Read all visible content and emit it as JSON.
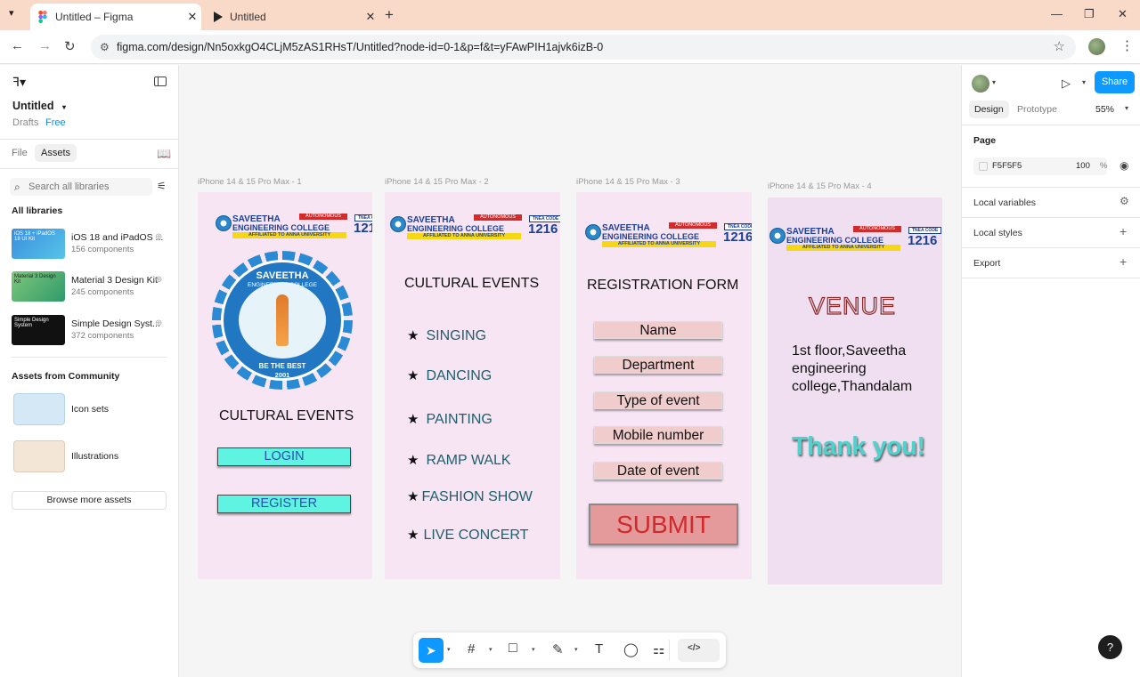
{
  "browser": {
    "tabs": [
      {
        "title": "Untitled – Figma",
        "close": "✕"
      },
      {
        "title": "Untitled",
        "close": "✕"
      }
    ],
    "new_tab": "+",
    "url": "figma.com/design/Nn5oxkgO4CLjM5zAS1RHsT/Untitled?node-id=0-1&p=f&t=yFAwPIH1ajvk6izB-0",
    "icons": [
      "chevron-down-icon",
      "figma-favicon",
      "play-favicon",
      "minimize-icon",
      "maximize-icon",
      "close-icon",
      "back-icon",
      "forward-icon",
      "reload-icon",
      "site-info-icon",
      "bookmark-star-icon",
      "profile-avatar",
      "kebab-menu-icon"
    ]
  },
  "left_panel": {
    "file_name": "Untitled",
    "drafts": "Drafts",
    "plan": "Free",
    "tabs": {
      "file": "File",
      "assets": "Assets"
    },
    "search_placeholder": "Search all libraries",
    "all_libraries_heading": "All libraries",
    "libraries": [
      {
        "name": "iOS 18 and iPadOS ...",
        "count": "156 components",
        "thumb_text": "iOS 18 + iPadOS 18 UI Kit",
        "color": "#3a8dde"
      },
      {
        "name": "Material 3 Design Kit",
        "count": "245 components",
        "thumb_text": "Material 3 Design Kit",
        "color": "#7fc77a"
      },
      {
        "name": "Simple Design Syst...",
        "count": "372 components",
        "thumb_text": "Simple Design System",
        "color": "#111111"
      }
    ],
    "community_heading": "Assets from Community",
    "community": [
      {
        "name": "Icon sets"
      },
      {
        "name": "Illustrations"
      }
    ],
    "browse_button": "Browse more assets"
  },
  "canvas": {
    "frames": [
      {
        "label": "iPhone 14 & 15 Pro Max - 1"
      },
      {
        "label": "iPhone 14 & 15 Pro Max - 2"
      },
      {
        "label": "iPhone 14 & 15 Pro Max - 3"
      },
      {
        "label": "iPhone 14 & 15 Pro Max - 4"
      }
    ],
    "college_logo": {
      "line1": "SAVEETHA",
      "line2": "ENGINEERING COLLEGE",
      "autonomous": "AUTONOMOUS",
      "affiliated": "AFFILIATED TO ANNA UNIVERSITY",
      "tnea_label": "TNEA CODE",
      "tnea_code": "1216"
    },
    "emblem": {
      "name": "SAVEETHA",
      "sub": "ENGINEERING COLLEGE",
      "motto": "BE THE BEST",
      "year": "2001"
    },
    "frame1": {
      "title": "CULTURAL EVENTS",
      "login": "LOGIN",
      "register": "REGISTER"
    },
    "frame2": {
      "title": "CULTURAL EVENTS",
      "bullet": "★",
      "events": [
        "SINGING",
        "DANCING",
        "PAINTING",
        "RAMP WALK",
        "FASHION SHOW",
        "LIVE CONCERT"
      ]
    },
    "frame3": {
      "title": "REGISTRATION FORM",
      "fields": [
        "Name",
        "Department",
        "Type of event",
        "Mobile number",
        "Date of event"
      ],
      "submit": "SUBMIT"
    },
    "frame4": {
      "venue_heading": "VENUE",
      "address": "1st floor,Saveetha engineering college,Thandalam",
      "thanks": "Thank you!"
    },
    "colors": {
      "frame_bg": "#f7e5f4",
      "button_cyan": "#5ff3e1",
      "field_pink": "#f1cccc",
      "submit_bg": "#e4999b",
      "thanks_teal": "#4fd2cd"
    }
  },
  "right_panel": {
    "share": "Share",
    "tabs": {
      "design": "Design",
      "prototype": "Prototype"
    },
    "zoom": "55%",
    "page_heading": "Page",
    "page_color": "F5F5F5",
    "page_opacity": "100",
    "percent": "%",
    "rows": [
      "Local variables",
      "Local styles",
      "Export"
    ]
  },
  "toolbar": {
    "tools": [
      "move-tool",
      "frame-tool",
      "rectangle-tool",
      "pen-tool",
      "text-tool",
      "comment-tool",
      "actions-tool",
      "dev-mode-toggle"
    ],
    "text_tool_glyph": "T"
  },
  "help": "?"
}
